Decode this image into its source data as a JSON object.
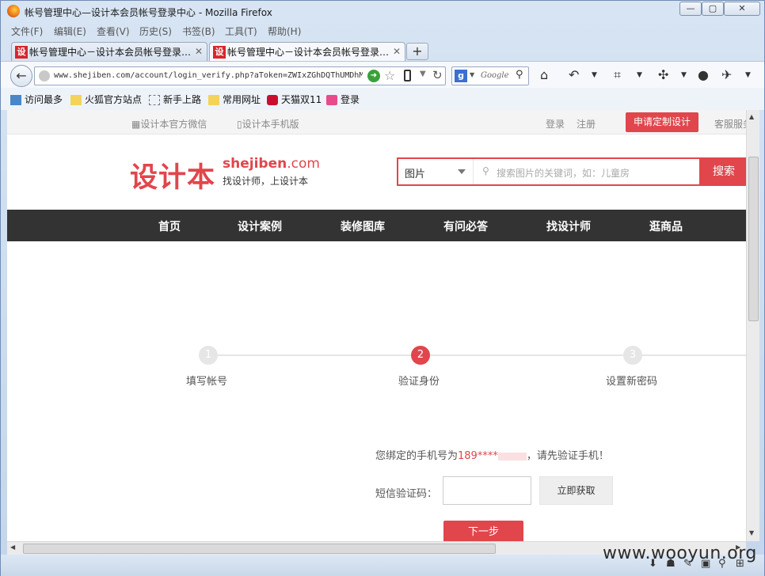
{
  "window": {
    "title": "帐号管理中心—设计本会员帐号登录中心 - Mozilla Firefox",
    "min": "—",
    "max": "▢",
    "close": "✕"
  },
  "menu": [
    "文件(F)",
    "编辑(E)",
    "查看(V)",
    "历史(S)",
    "书签(B)",
    "工具(T)",
    "帮助(H)"
  ],
  "tabs": [
    {
      "icon": "设",
      "label": "帐号管理中心－设计本会员帐号登录…",
      "close": "✕"
    },
    {
      "icon": "设",
      "label": "帐号管理中心－设计本会员帐号登录…",
      "close": "✕"
    }
  ],
  "newtab": "+",
  "nav": {
    "back": "←",
    "url": "www.shejiben.com/account/login_verify.php?aToken=ZWIxZGhDQThUMDhM",
    "search_engine_icon": "g",
    "search_placeholder": "Google",
    "reload": "↻",
    "star": "☆"
  },
  "bookmarks": [
    "访问最多",
    "火狐官方站点",
    "新手上路",
    "常用网址",
    "天猫双11",
    "登录"
  ],
  "site": {
    "top": {
      "wechat": "设计本官方微信",
      "mobile": "设计本手机版",
      "login": "登录",
      "register": "注册",
      "custom": "申请定制设计",
      "service": "客服服务"
    },
    "logo": {
      "cn": "设计本",
      "en": "shejiben",
      "com": ".com",
      "tagline": "找设计师，上设计本"
    },
    "search": {
      "category": "图片",
      "placeholder": "搜索图片的关键词，如：儿童房",
      "button": "搜索"
    },
    "nav": [
      "首页",
      "设计案例",
      "装修图库",
      "有问必答",
      "找设计师",
      "逛商品"
    ],
    "steps": [
      {
        "num": "1",
        "label": "填写帐号"
      },
      {
        "num": "2",
        "label": "验证身份"
      },
      {
        "num": "3",
        "label": "设置新密码"
      }
    ],
    "verify": {
      "prefix": "您绑定的手机号为",
      "phone": "189****",
      "suffix": "，请先验证手机！",
      "code_label": "短信验证码：",
      "get_code": "立即获取",
      "next": "下一步"
    }
  },
  "watermark": "www.wooyun.org",
  "colors": {
    "brand_red": "#e0464c",
    "nav_dark": "#333333"
  }
}
